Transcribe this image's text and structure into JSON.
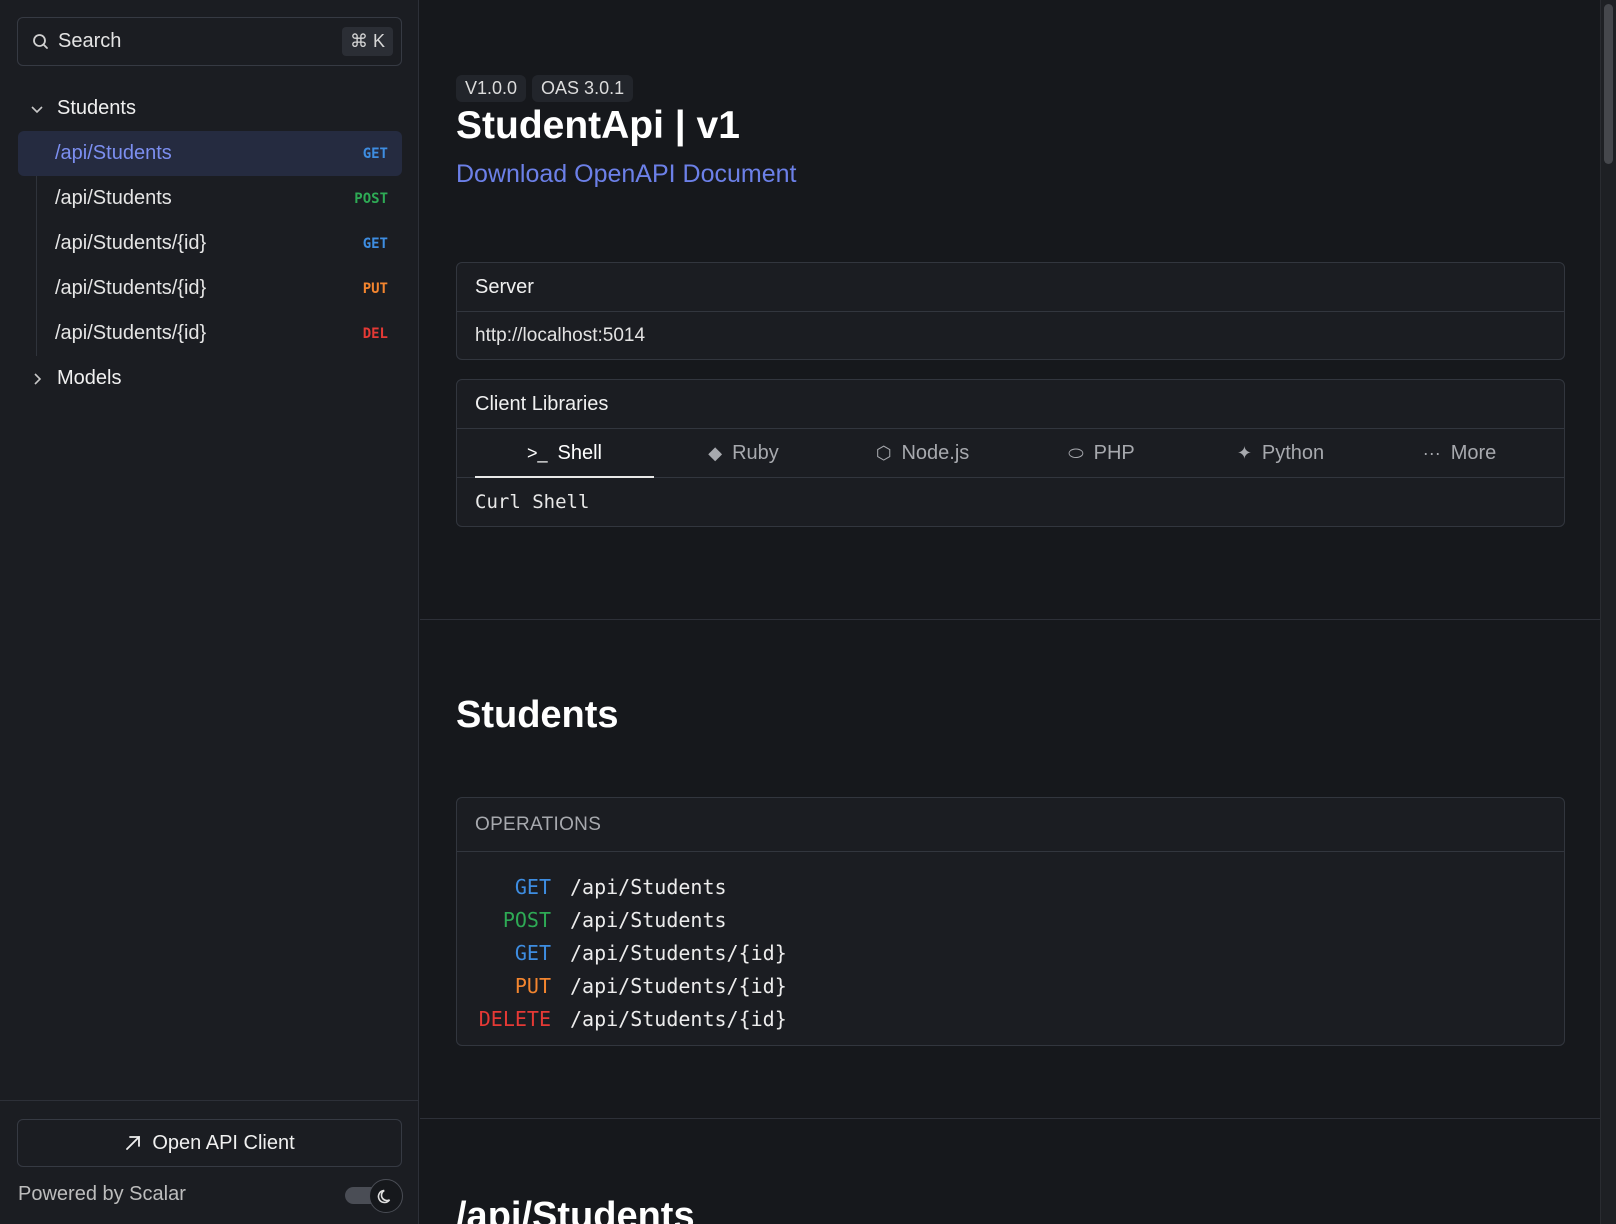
{
  "sidebar": {
    "search": {
      "label": "Search",
      "shortcut": "⌘ K"
    },
    "groups": [
      {
        "label": "Students",
        "expanded": true,
        "items": [
          {
            "path": "/api/Students",
            "method": "GET",
            "active": true
          },
          {
            "path": "/api/Students",
            "method": "POST"
          },
          {
            "path": "/api/Students/{id}",
            "method": "GET"
          },
          {
            "path": "/api/Students/{id}",
            "method": "PUT"
          },
          {
            "path": "/api/Students/{id}",
            "method": "DEL"
          }
        ]
      },
      {
        "label": "Models",
        "expanded": false
      }
    ],
    "footer": {
      "open_client_label": "Open API Client",
      "powered_by": "Powered by Scalar"
    }
  },
  "header": {
    "version": "V1.0.0",
    "oas": "OAS 3.0.1",
    "title": "StudentApi | v1",
    "download_link": "Download OpenAPI Document"
  },
  "server": {
    "label": "Server",
    "url": "http://localhost:5014"
  },
  "client_libraries": {
    "label": "Client Libraries",
    "tabs": [
      {
        "label": "Shell",
        "icon": "terminal-icon",
        "active": true
      },
      {
        "label": "Ruby",
        "icon": "ruby-icon"
      },
      {
        "label": "Node.js",
        "icon": "nodejs-icon"
      },
      {
        "label": "PHP",
        "icon": "php-icon"
      },
      {
        "label": "Python",
        "icon": "python-icon"
      },
      {
        "label": "More",
        "icon": "more-icon"
      }
    ],
    "selected": "Curl Shell"
  },
  "section": {
    "title": "Students",
    "operations_label": "OPERATIONS",
    "operations": [
      {
        "method": "GET",
        "path": "/api/Students"
      },
      {
        "method": "POST",
        "path": "/api/Students"
      },
      {
        "method": "GET",
        "path": "/api/Students/{id}"
      },
      {
        "method": "PUT",
        "path": "/api/Students/{id}"
      },
      {
        "method": "DELETE",
        "path": "/api/Students/{id}"
      }
    ]
  },
  "next_section": {
    "title": "/api/Students"
  },
  "colors": {
    "get": "#3e8de1",
    "post": "#2eaa55",
    "put": "#f3852f",
    "delete": "#e53935",
    "link": "#6c80e8"
  }
}
